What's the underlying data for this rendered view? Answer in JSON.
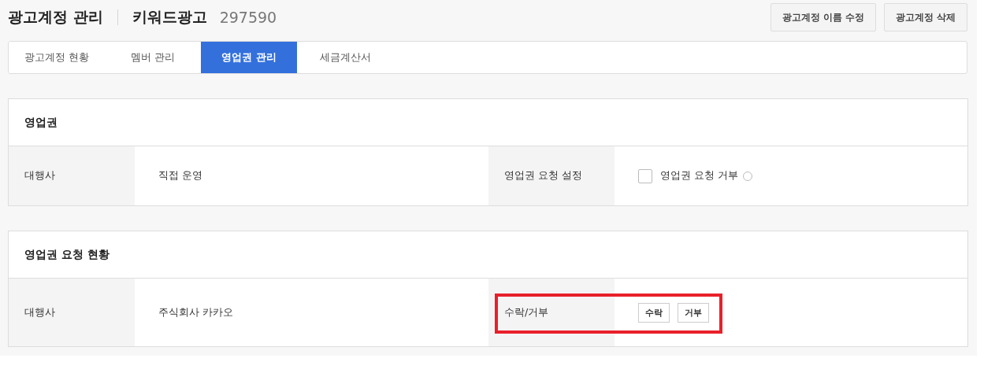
{
  "header": {
    "title": "광고계정 관리",
    "account_type": "키워드광고",
    "account_id": "297590",
    "buttons": [
      "광고계정 이름 수정",
      "광고계정 삭제"
    ]
  },
  "tabs": [
    {
      "label": "광고계정 현황",
      "selected": false
    },
    {
      "label": "멤버 관리",
      "selected": false
    },
    {
      "label": "영업권 관리",
      "selected": true
    },
    {
      "label": "세금계산서",
      "selected": false
    }
  ],
  "sections": [
    {
      "title": "영업권",
      "highlighted": false,
      "row": {
        "label_1": "대행사",
        "value_1": "직접 운영",
        "label_2": "영업권 요청 설정",
        "kind": "checkbox",
        "checkbox": {
          "label": "영업권 요청 거부",
          "checked": false
        }
      }
    },
    {
      "title": "영업권 요청 현황",
      "highlighted": true,
      "row": {
        "label_1": "대행사",
        "value_1": "주식회사 카카오",
        "label_2": "수락/거부",
        "kind": "buttons",
        "buttons": [
          "수락",
          "거부"
        ]
      }
    }
  ]
}
